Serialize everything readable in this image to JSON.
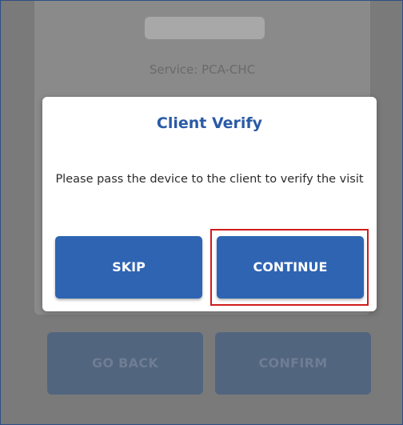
{
  "background": {
    "service_text": "Service: PCA-CHC",
    "go_back_label": "GO BACK",
    "confirm_label": "CONFIRM"
  },
  "dialog": {
    "title": "Client Verify",
    "message": "Please pass the device to the client to verify the visit",
    "skip_label": "SKIP",
    "continue_label": "CONTINUE"
  },
  "colors": {
    "accent": "#2f64b3",
    "title": "#2a5aa5",
    "highlight": "#d01c1c",
    "overlay": "#7a7a7a"
  }
}
